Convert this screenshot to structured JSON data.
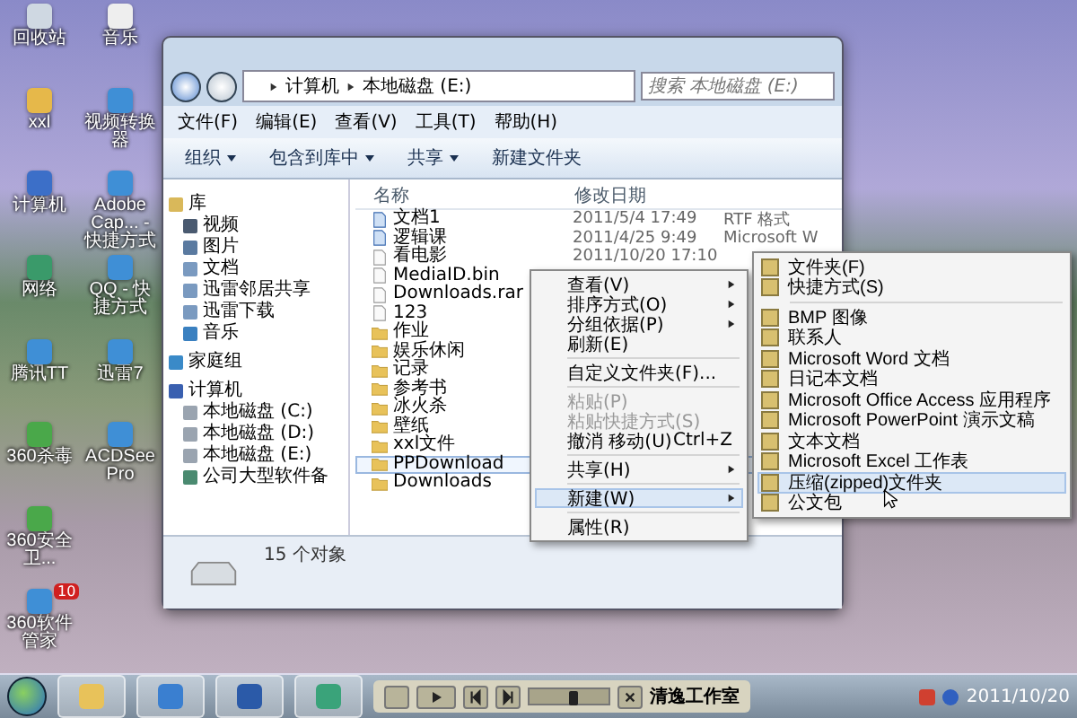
{
  "desktop_icons": [
    {
      "label": "回收站",
      "kind": "bin"
    },
    {
      "label": "xxl",
      "kind": "user"
    },
    {
      "label": "计算机",
      "kind": "pc"
    },
    {
      "label": "网络",
      "kind": "net"
    },
    {
      "label": "腾讯TT",
      "kind": "app"
    },
    {
      "label": "360杀毒",
      "kind": "shield"
    },
    {
      "label": "360安全卫...",
      "kind": "shield"
    },
    {
      "label": "360软件管家",
      "kind": "app",
      "badge": "10"
    },
    {
      "label": "音乐",
      "kind": "file"
    },
    {
      "label": "视频转换器",
      "kind": "app"
    },
    {
      "label": "Adobe Cap... - 快捷方式",
      "kind": "app"
    },
    {
      "label": "QQ - 快捷方式",
      "kind": "app"
    },
    {
      "label": "迅雷7",
      "kind": "app"
    },
    {
      "label": "ACDSee Pro",
      "kind": "app"
    }
  ],
  "explorer": {
    "path": [
      "计算机",
      "本地磁盘 (E:)"
    ],
    "search": {
      "placeholder": "搜索 本地磁盘 (E:)"
    },
    "menu": [
      "文件(F)",
      "编辑(E)",
      "查看(V)",
      "工具(T)",
      "帮助(H)"
    ],
    "toolbar": [
      {
        "label": "组织",
        "dropdown": true
      },
      {
        "label": "包含到库中",
        "dropdown": true
      },
      {
        "label": "共享",
        "dropdown": true
      },
      {
        "label": "新建文件夹",
        "dropdown": false
      }
    ],
    "nav": [
      {
        "label": "库",
        "kind": "library",
        "children": [
          {
            "label": "视频",
            "kind": "video"
          },
          {
            "label": "图片",
            "kind": "picture"
          },
          {
            "label": "文档",
            "kind": "doc"
          },
          {
            "label": "迅雷邻居共享",
            "kind": "doc"
          },
          {
            "label": "迅雷下载",
            "kind": "doc"
          },
          {
            "label": "音乐",
            "kind": "music"
          }
        ]
      },
      {
        "label": "家庭组",
        "kind": "group"
      },
      {
        "label": "计算机",
        "kind": "pc",
        "children": [
          {
            "label": "本地磁盘 (C:)",
            "kind": "drive"
          },
          {
            "label": "本地磁盘 (D:)",
            "kind": "drive"
          },
          {
            "label": "本地磁盘 (E:)",
            "kind": "drive"
          },
          {
            "label": "公司大型软件备",
            "kind": "net"
          }
        ]
      }
    ],
    "columns": [
      "名称",
      "修改日期"
    ],
    "files": [
      {
        "name": "文档1",
        "kind": "doc",
        "date": "2011/5/4 17:49",
        "type": "RTF 格式",
        "hovered": false
      },
      {
        "name": "逻辑课",
        "kind": "doc",
        "date": "2011/4/25 9:49",
        "type": "Microsoft W",
        "hovered": false
      },
      {
        "name": "看电影",
        "kind": "file",
        "date": "2011/10/20 17:10",
        "hovered": false
      },
      {
        "name": "MediaID.bin",
        "kind": "file",
        "hovered": false
      },
      {
        "name": "Downloads.rar",
        "kind": "file",
        "hovered": false
      },
      {
        "name": "123",
        "kind": "file",
        "hovered": false
      },
      {
        "name": "作业",
        "kind": "folder",
        "hovered": false
      },
      {
        "name": "娱乐休闲",
        "kind": "folder",
        "hovered": false
      },
      {
        "name": "记录",
        "kind": "folder",
        "hovered": false
      },
      {
        "name": "参考书",
        "kind": "folder",
        "hovered": false
      },
      {
        "name": "冰火杀",
        "kind": "folder",
        "hovered": false
      },
      {
        "name": "壁纸",
        "kind": "folder",
        "hovered": false
      },
      {
        "name": "xxl文件",
        "kind": "folder",
        "hovered": false
      },
      {
        "name": "PPDownload",
        "kind": "folder",
        "hovered": true
      },
      {
        "name": "Downloads",
        "kind": "folder",
        "hovered": false
      }
    ],
    "status": "15 个对象"
  },
  "context_menu": [
    {
      "kind": "item",
      "label": "查看(V)",
      "submenu": true,
      "disabled": false,
      "highlighted": false
    },
    {
      "kind": "item",
      "label": "排序方式(O)",
      "submenu": true,
      "disabled": false,
      "highlighted": false
    },
    {
      "kind": "item",
      "label": "分组依据(P)",
      "submenu": true,
      "disabled": false,
      "highlighted": false
    },
    {
      "kind": "item",
      "label": "刷新(E)",
      "submenu": false,
      "disabled": false,
      "highlighted": false
    },
    {
      "kind": "separator"
    },
    {
      "kind": "item",
      "label": "自定义文件夹(F)...",
      "submenu": false,
      "disabled": false,
      "highlighted": false
    },
    {
      "kind": "separator"
    },
    {
      "kind": "item",
      "label": "粘贴(P)",
      "submenu": false,
      "disabled": true,
      "highlighted": false
    },
    {
      "kind": "item",
      "label": "粘贴快捷方式(S)",
      "submenu": false,
      "disabled": true,
      "highlighted": false
    },
    {
      "kind": "item",
      "label": "撤消 移动(U)",
      "shortcut": "Ctrl+Z",
      "submenu": false,
      "disabled": false,
      "highlighted": false
    },
    {
      "kind": "separator"
    },
    {
      "kind": "item",
      "label": "共享(H)",
      "submenu": true,
      "disabled": false,
      "highlighted": false
    },
    {
      "kind": "separator"
    },
    {
      "kind": "item",
      "label": "新建(W)",
      "submenu": true,
      "disabled": false,
      "highlighted": true
    },
    {
      "kind": "separator"
    },
    {
      "kind": "item",
      "label": "属性(R)",
      "submenu": false,
      "disabled": false,
      "highlighted": false
    }
  ],
  "new_submenu": [
    {
      "kind": "item",
      "label": "文件夹(F)",
      "highlighted": false
    },
    {
      "kind": "item",
      "label": "快捷方式(S)",
      "highlighted": false
    },
    {
      "kind": "separator"
    },
    {
      "kind": "item",
      "label": "BMP 图像",
      "highlighted": false
    },
    {
      "kind": "item",
      "label": "联系人",
      "highlighted": false
    },
    {
      "kind": "item",
      "label": "Microsoft Word 文档",
      "highlighted": false
    },
    {
      "kind": "item",
      "label": "日记本文档",
      "highlighted": false
    },
    {
      "kind": "item",
      "label": "Microsoft Office Access 应用程序",
      "highlighted": false
    },
    {
      "kind": "item",
      "label": "Microsoft PowerPoint 演示文稿",
      "highlighted": false
    },
    {
      "kind": "item",
      "label": "文本文档",
      "highlighted": false
    },
    {
      "kind": "item",
      "label": "Microsoft Excel 工作表",
      "highlighted": false
    },
    {
      "kind": "item",
      "label": "压缩(zipped)文件夹",
      "highlighted": true
    },
    {
      "kind": "item",
      "label": "公文包",
      "highlighted": false
    }
  ],
  "taskbar": {
    "player": {
      "title": "清逸工作室",
      "level": 0.55
    },
    "date": "2011/10/20"
  }
}
